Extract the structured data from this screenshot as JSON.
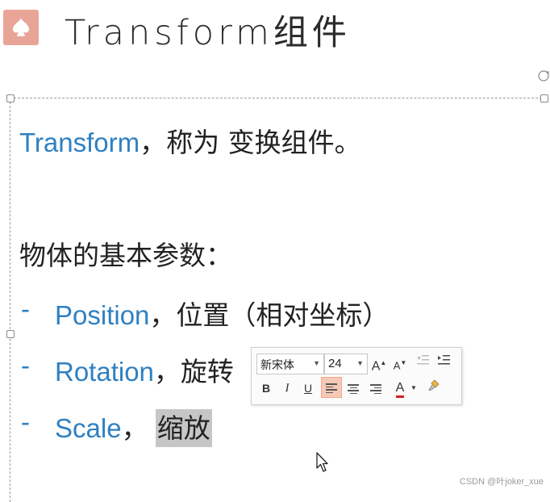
{
  "title": {
    "text": "Transform组件"
  },
  "lines": {
    "line1_en": "Transform",
    "line1_cn": "，称为 变换组件。",
    "line2": "物体的基本参数：",
    "dash": "-",
    "items": [
      {
        "en": "Position",
        "cn": "，位置（相对坐标）"
      },
      {
        "en": "Rotation",
        "cn": "，旋转"
      },
      {
        "en": "Scale",
        "cn_sep": "，",
        "cn": "缩放"
      }
    ]
  },
  "toolbar": {
    "font_value": "新宋体",
    "size_value": "24",
    "grow_label": "A",
    "shrink_label": "A",
    "bold_label": "B",
    "italic_label": "I",
    "underline_label": "U",
    "font_color_label": "A",
    "font_color": "#d61f1f",
    "highlight_color": "#f7c9b5"
  },
  "watermark": "CSDN @叶joker_xue",
  "colors": {
    "accent_blue": "#2f80c1",
    "logo_bg": "#e8a597",
    "selection_highlight": "#c6c6c6"
  }
}
